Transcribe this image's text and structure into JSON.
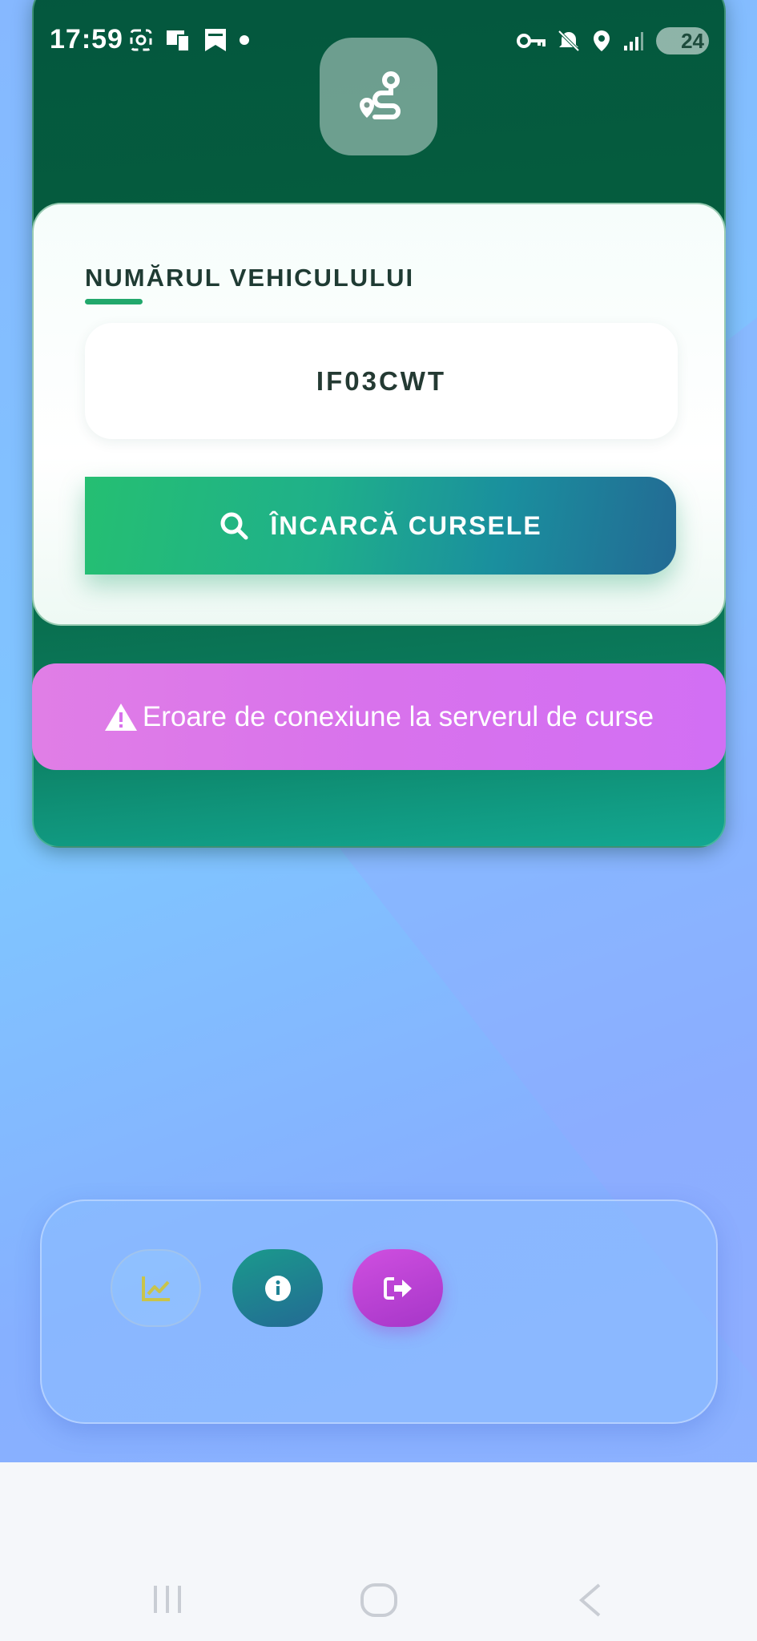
{
  "status_bar": {
    "time": "17:59",
    "battery": "24",
    "left_icons": [
      "screenshot-icon",
      "cast-icon",
      "bookmark-icon",
      "dot-icon"
    ],
    "right_icons": [
      "vpn-key-icon",
      "mute-icon",
      "location-icon",
      "signal-icon"
    ]
  },
  "app": {
    "logo_icon": "route-icon"
  },
  "form": {
    "label": "NUMĂRUL VEHICULULUI",
    "plate_value": "IF03CWT",
    "load_button_label": "ÎNCARCĂ CURSELE",
    "load_button_icon": "search-icon"
  },
  "error": {
    "icon": "warning-icon",
    "message": "Eroare de conexiune la serverul de curse"
  },
  "bottom_nav": {
    "buttons": [
      {
        "icon": "chart-icon"
      },
      {
        "icon": "info-icon"
      },
      {
        "icon": "logout-icon"
      }
    ]
  },
  "colors": {
    "card_green": "#04573e",
    "accent_green": "#22a86c",
    "error_purple": "#d872ec",
    "button_teal": "#1a8f9e"
  }
}
